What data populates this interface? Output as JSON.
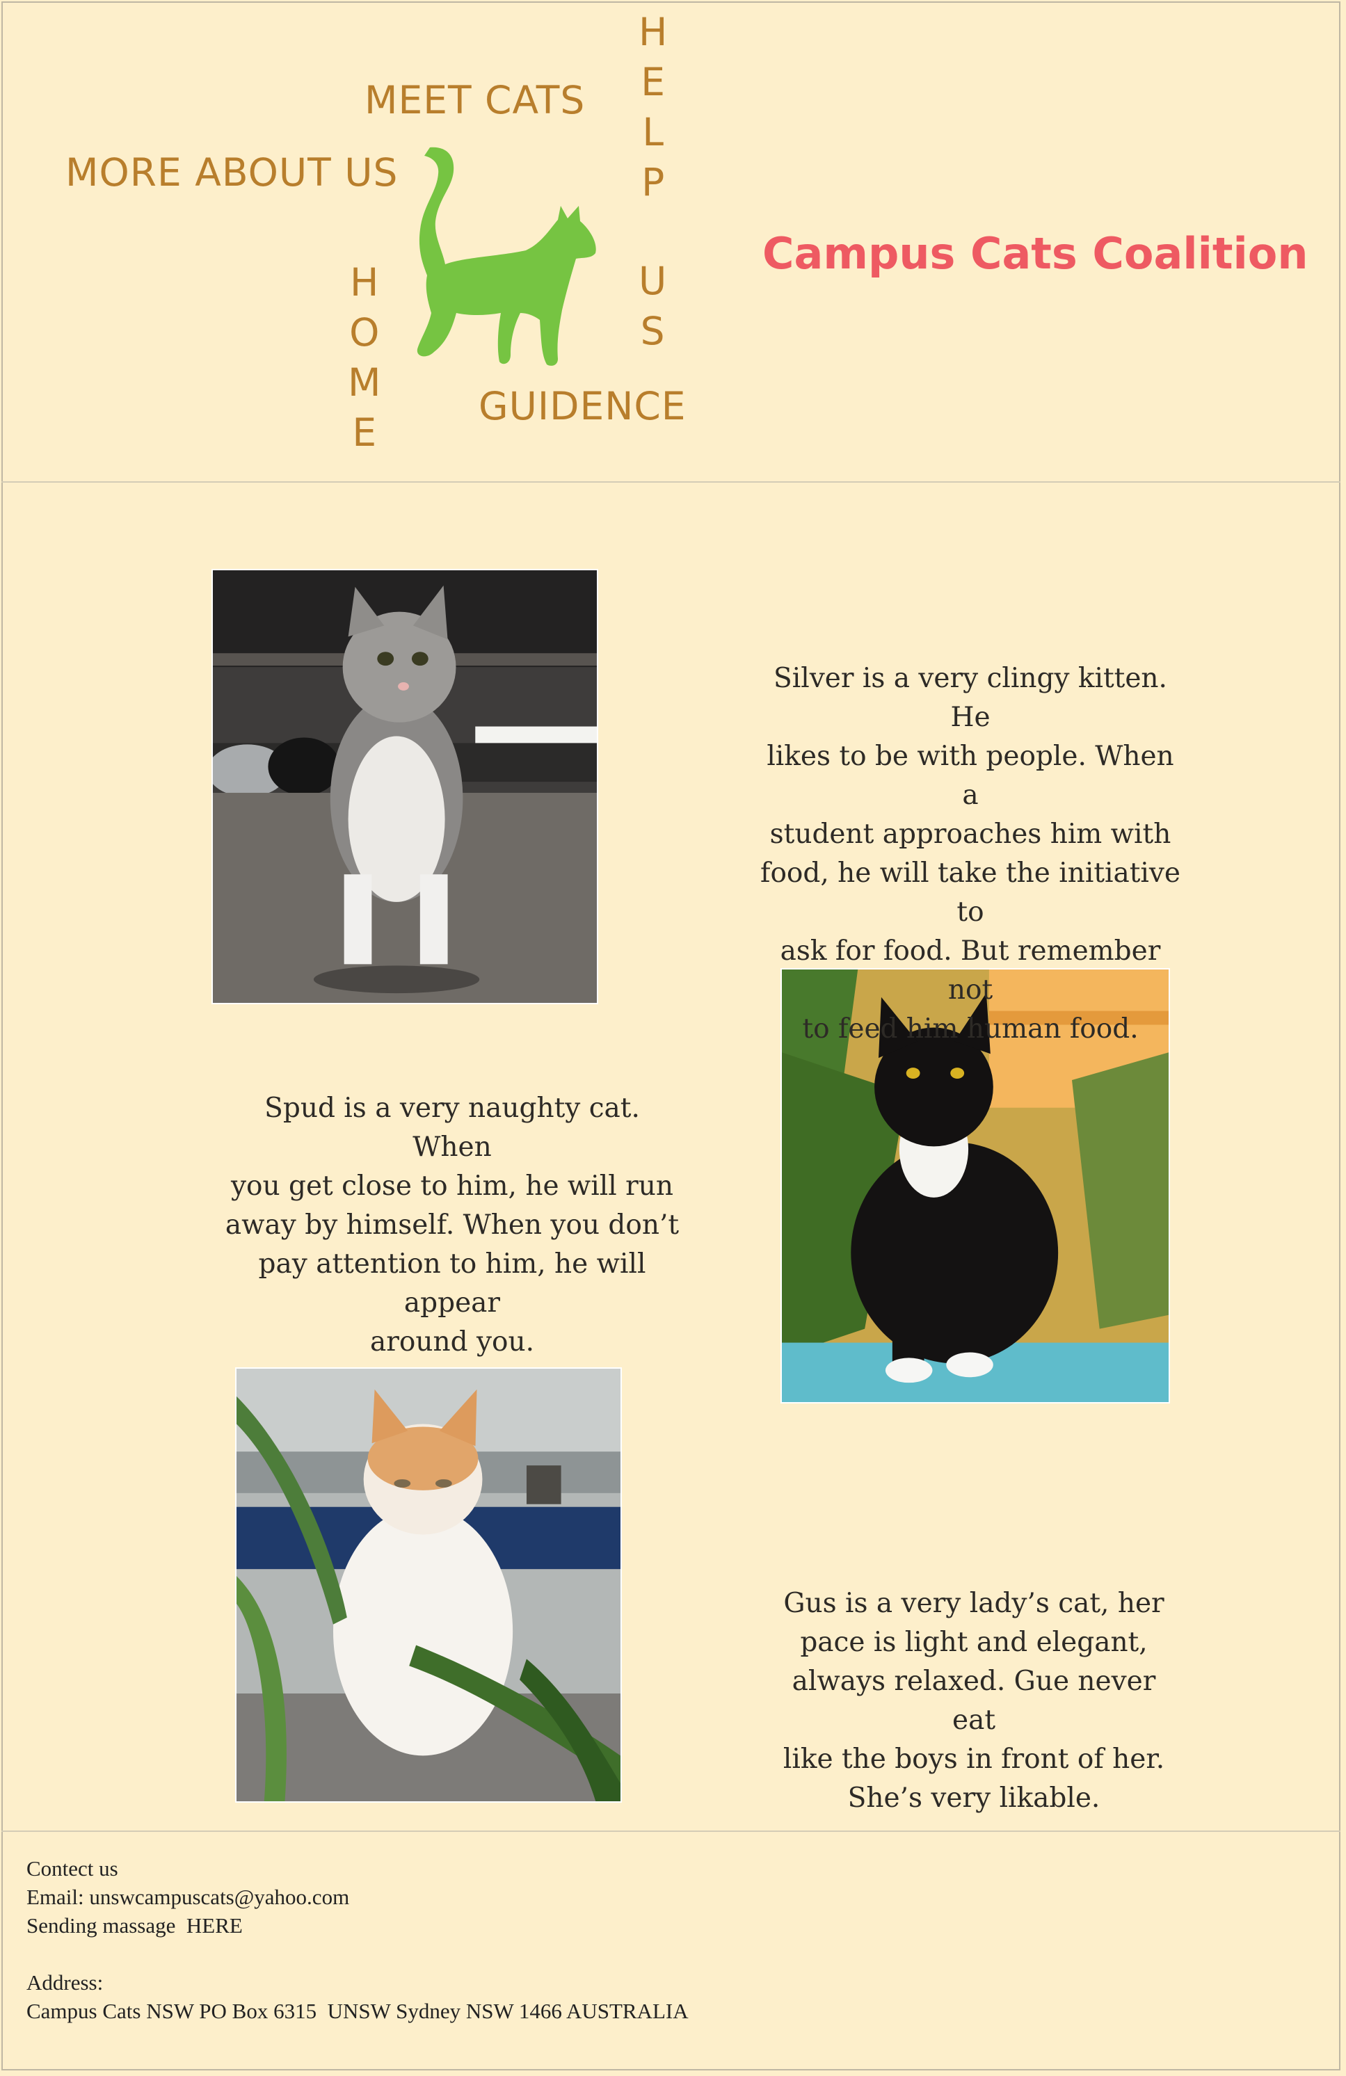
{
  "header": {
    "nav": {
      "meet_cats": "MEET CATS",
      "more_about_us": "MORE ABOUT US",
      "home": [
        "H",
        "O",
        "M",
        "E"
      ],
      "help": [
        "H",
        "E",
        "L",
        "P"
      ],
      "us": [
        "U",
        "S"
      ],
      "guidence": "GUIDENCE"
    },
    "brand_title": "Campus Cats Coalition",
    "logo_icon": "cat-silhouette-icon",
    "logo_color": "#76c442"
  },
  "cats": [
    {
      "name": "Silver",
      "description": "Silver is a very clingy kitten. He\nlikes to be with people. When a\nstudent approaches him with\nfood, he will take the initiative to\nask for food. But remember not\nto feed him human food."
    },
    {
      "name": "Spud",
      "description": "Spud is a very naughty cat. When\nyou get close to him, he will run\naway by himself. When you don’t\npay attention to him, he will appear\naround you."
    },
    {
      "name": "Gus",
      "description": "Gus is a very lady’s cat, her\npace is light and elegant,\nalways relaxed. Gue never eat\nlike the boys in front of her.\nShe’s very likable."
    }
  ],
  "footer": {
    "contact_heading": "Contect us",
    "email_label": "Email:",
    "email": "unswcampuscats@yahoo.com",
    "message_label": "Sending massage",
    "message_link": "HERE",
    "address_heading": "Address:",
    "address": "Campus Cats NSW PO Box 6315  UNSW Sydney NSW 1466 AUSTRALIA"
  },
  "colors": {
    "background": "#fdefcb",
    "nav": "#b87e2c",
    "brand": "#ee5a62"
  }
}
